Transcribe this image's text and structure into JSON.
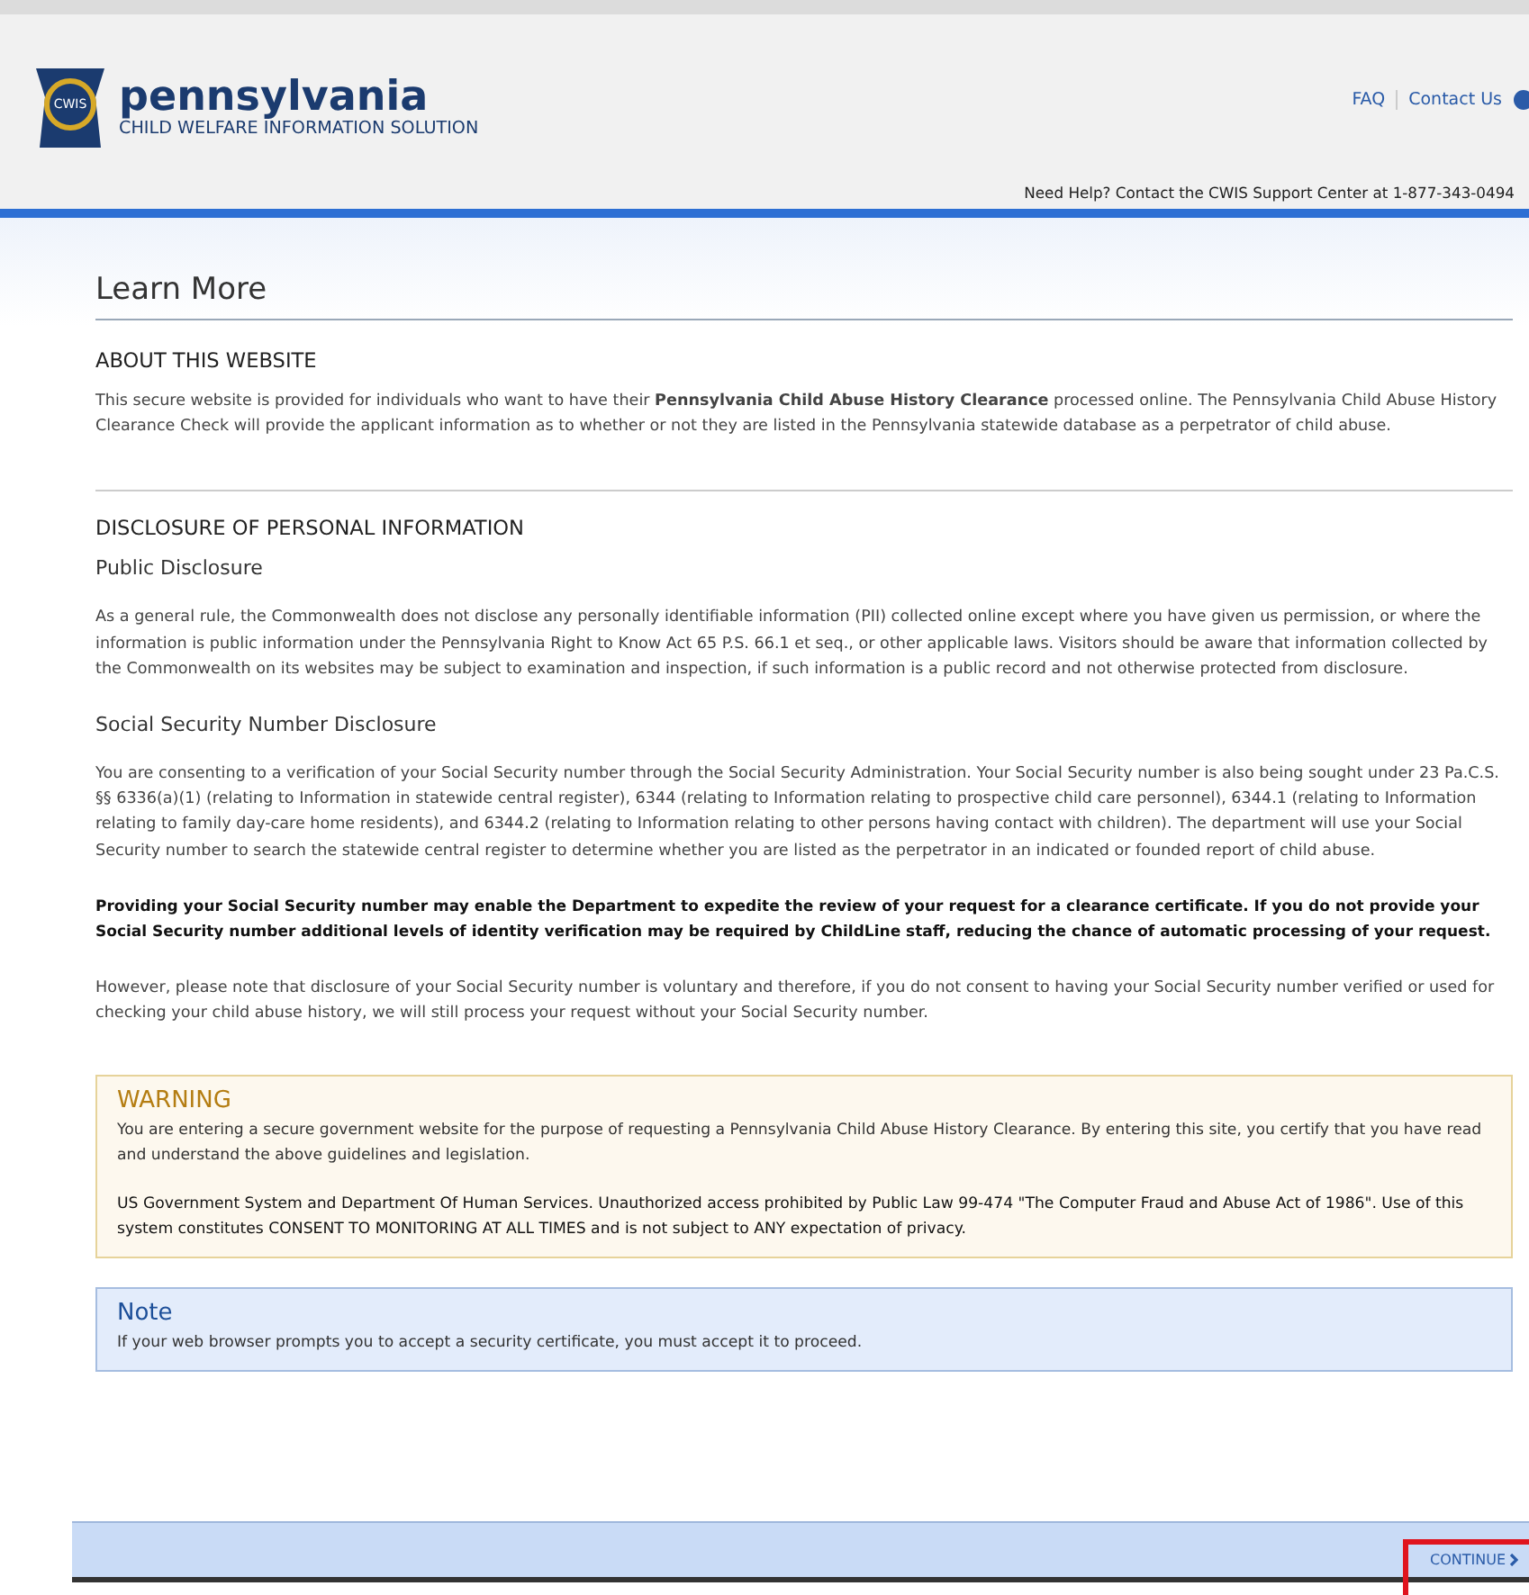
{
  "site_header": {
    "logo_text": "CWIS",
    "state_name": "pennsylvania",
    "program_name": "CHILD WELFARE INFORMATION SOLUTION",
    "links": [
      {
        "label": "FAQ"
      },
      {
        "label": "Contact Us"
      }
    ],
    "help_text": "Need Help? Contact the CWIS Support Center at 1-877-343-0494"
  },
  "page_title": "Learn More",
  "blocks": [
    {
      "kind": "section_heading",
      "text": "ABOUT THIS WEBSITE"
    },
    {
      "kind": "paragraph",
      "text": "This secure website is provided for individuals who want to have their **Pennsylvania Child Abuse History Clearance** processed online. The Pennsylvania Child Abuse History Clearance Check will provide the applicant information as to whether or not they are listed in the Pennsylvania statewide database as a perpetrator of child abuse."
    },
    {
      "kind": "divider"
    },
    {
      "kind": "section_heading",
      "text": "DISCLOSURE OF PERSONAL INFORMATION"
    },
    {
      "kind": "subheading",
      "text": "Public Disclosure"
    },
    {
      "kind": "paragraph",
      "text": "As a general rule, the Commonwealth does not disclose any personally identifiable information (PII) collected online except where you have given us permission, or where the information is public information under the Pennsylvania Right to Know Act 65 P.S. 66.1 et seq., or other applicable laws. Visitors should be aware that information collected by the Commonwealth on its websites may be subject to examination and inspection, if such information is a public record and not otherwise protected from disclosure."
    },
    {
      "kind": "subheading",
      "text": "Social Security Number Disclosure"
    },
    {
      "kind": "paragraph",
      "text": "You are consenting to a verification of your Social Security number through the Social Security Administration. Your Social Security number is also being sought under 23 Pa.C.S. §§ 6336(a)(1) (relating to Information in statewide central register), 6344 (relating to Information relating to prospective child care personnel), 6344.1 (relating to Information relating to family day-care home residents), and 6344.2 (relating to Information relating to other persons having contact with children). The department will use your Social Security number to search the statewide central register to determine whether you are listed as the perpetrator in an indicated or founded report of child abuse."
    },
    {
      "kind": "emphasis",
      "text": "Providing your Social Security number may enable the Department to expedite the review of your request for a clearance certificate.  If you do not provide your Social Security number additional levels of identity verification may be required by ChildLine staff, reducing the chance of automatic processing of your request."
    },
    {
      "kind": "paragraph",
      "text": "However, please note that disclosure of your Social Security number is voluntary and therefore, if you do not consent to having your Social Security number verified or used for checking your child abuse history, we will still process your request without your Social Security number."
    }
  ],
  "callouts": [
    {
      "kind": "warning",
      "title": "WARNING",
      "paragraphs": [
        "You are entering a secure government website for the purpose of requesting a Pennsylvania Child Abuse History Clearance. By entering this site, you certify that you have read and understand the above guidelines and legislation.",
        "US Government System and Department Of Human Services. Unauthorized access prohibited by Public Law 99-474 \"The Computer Fraud and Abuse Act of 1986\". Use of this system constitutes CONSENT TO MONITORING AT ALL TIMES and is not subject to ANY expectation of privacy."
      ]
    },
    {
      "kind": "note",
      "title": "Note",
      "paragraphs": [
        "If your web browser prompts you to accept a security certificate, you must accept it to proceed."
      ]
    }
  ],
  "footer": {
    "continue_label": "CONTINUE",
    "highlighted": true
  }
}
